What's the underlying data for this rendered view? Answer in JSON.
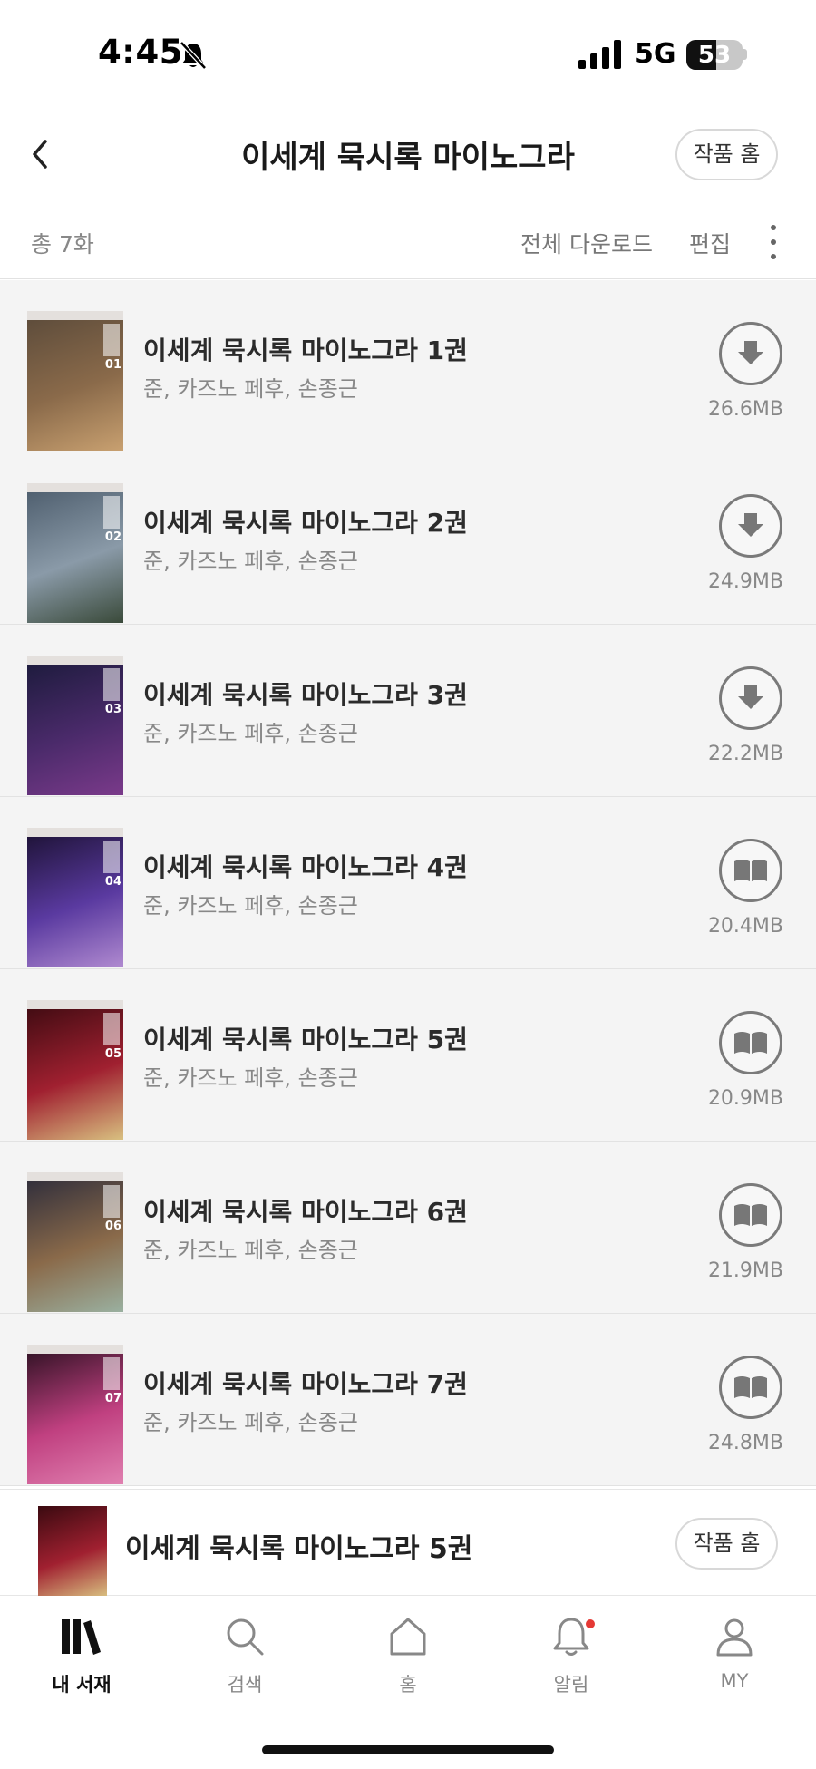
{
  "status_bar": {
    "time": "4:45",
    "network": "5G",
    "battery": "53",
    "battery_level": 0.53
  },
  "header": {
    "title": "이세계 묵시록 마이노그라",
    "work_home_label": "작품 홈"
  },
  "toolbar": {
    "total": "총 7화",
    "download_all": "전체 다운로드",
    "edit": "편집"
  },
  "volumes": [
    {
      "title": "이세계 묵시록 마이노그라 1권",
      "author": "준, 카즈노 페후, 손종근",
      "size": "26.6MB",
      "action": "download",
      "cover_number": "01",
      "cover_colors": [
        "#5a4a3a",
        "#8a6a4a",
        "#c8a070"
      ]
    },
    {
      "title": "이세계 묵시록 마이노그라 2권",
      "author": "준, 카즈노 페후, 손종근",
      "size": "24.9MB",
      "action": "download",
      "cover_number": "02",
      "cover_colors": [
        "#4a5a6a",
        "#8a9aa8",
        "#3a4a3a"
      ]
    },
    {
      "title": "이세계 묵시록 마이노그라 3권",
      "author": "준, 카즈노 페후, 손종근",
      "size": "22.2MB",
      "action": "download",
      "cover_number": "03",
      "cover_colors": [
        "#1a1a3a",
        "#4a2a6a",
        "#7a3a8a"
      ]
    },
    {
      "title": "이세계 묵시록 마이노그라 4권",
      "author": "준, 카즈노 페후, 손종근",
      "size": "20.4MB",
      "action": "read",
      "cover_number": "04",
      "cover_colors": [
        "#1a1030",
        "#5a3aa0",
        "#b08ad0"
      ]
    },
    {
      "title": "이세계 묵시록 마이노그라 5권",
      "author": "준, 카즈노 페후, 손종근",
      "size": "20.9MB",
      "action": "read",
      "cover_number": "05",
      "cover_colors": [
        "#3a0a10",
        "#a02030",
        "#d8c080"
      ]
    },
    {
      "title": "이세계 묵시록 마이노그라 6권",
      "author": "준, 카즈노 페후, 손종근",
      "size": "21.9MB",
      "action": "read",
      "cover_number": "06",
      "cover_colors": [
        "#2a2a3a",
        "#8a6a4a",
        "#9ab0a0"
      ]
    },
    {
      "title": "이세계 묵시록 마이노그라 7권",
      "author": "준, 카즈노 페후, 손종근",
      "size": "24.8MB",
      "action": "read",
      "cover_number": "07",
      "cover_colors": [
        "#2a1020",
        "#c04080",
        "#e080b0"
      ]
    }
  ],
  "now_reading": {
    "title": "이세계 묵시록 마이노그라 5권",
    "work_home_label": "작품 홈",
    "cover_colors": [
      "#3a0a10",
      "#a02030",
      "#d8c080"
    ]
  },
  "tabs": [
    {
      "label": "내 서재",
      "icon": "library-icon",
      "active": true
    },
    {
      "label": "검색",
      "icon": "search-icon",
      "active": false
    },
    {
      "label": "홈",
      "icon": "home-icon",
      "active": false
    },
    {
      "label": "알림",
      "icon": "bell-icon",
      "active": false,
      "badge": true
    },
    {
      "label": "MY",
      "icon": "profile-icon",
      "active": false
    }
  ]
}
